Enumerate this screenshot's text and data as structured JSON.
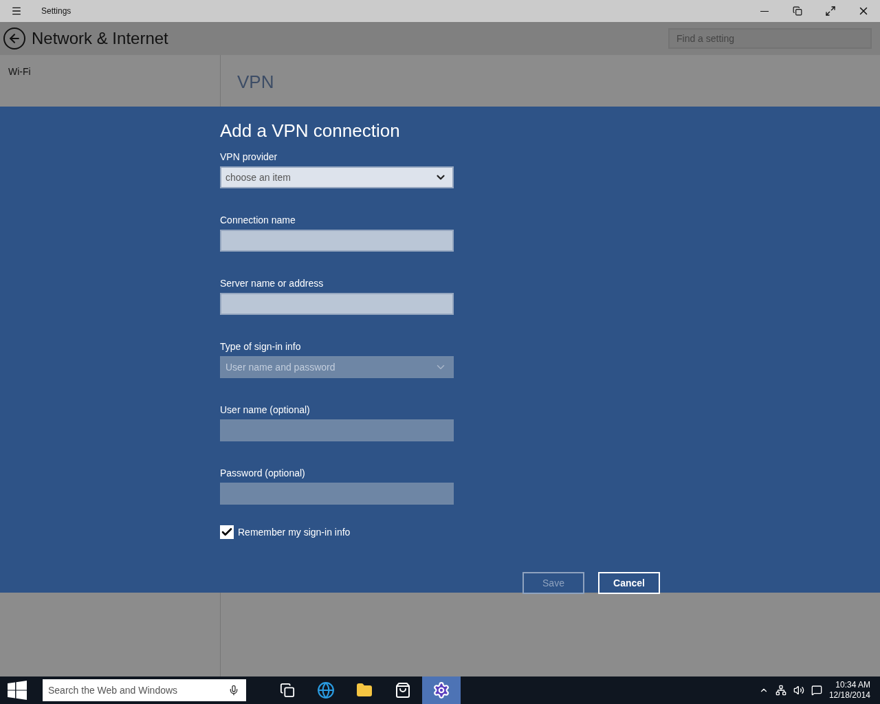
{
  "window": {
    "title": "Settings"
  },
  "header": {
    "title": "Network & Internet",
    "search": {
      "placeholder": "Find a setting"
    }
  },
  "sidebar": {
    "items": [
      {
        "label": "Wi-Fi"
      }
    ]
  },
  "page": {
    "title": "VPN"
  },
  "dialog": {
    "title": "Add a VPN connection",
    "fields": [
      {
        "kind": "select",
        "label": "VPN provider",
        "value": "choose an item",
        "disabled": false
      },
      {
        "kind": "text",
        "label": "Connection name",
        "disabled": false
      },
      {
        "kind": "text",
        "label": "Server name or address",
        "disabled": false
      },
      {
        "kind": "select",
        "label": "Type of sign-in info",
        "value": "User name and password",
        "disabled": true
      },
      {
        "kind": "text",
        "label": "User name (optional)",
        "disabled": true
      },
      {
        "kind": "text",
        "label": "Password (optional)",
        "disabled": true
      }
    ],
    "remember": {
      "label": "Remember my sign-in info",
      "checked": true
    },
    "buttons": [
      {
        "label": "Save",
        "disabled": true
      },
      {
        "label": "Cancel",
        "disabled": false
      }
    ]
  },
  "taskbar": {
    "search": {
      "placeholder": "Search the Web and Windows"
    },
    "apps": [
      {
        "kind": "taskview",
        "selected": false
      },
      {
        "kind": "browser",
        "selected": false
      },
      {
        "kind": "folder",
        "selected": false
      },
      {
        "kind": "store",
        "selected": false
      },
      {
        "kind": "settings",
        "selected": true
      }
    ],
    "clock": {
      "time": "10:34 AM",
      "date": "12/18/2014"
    }
  }
}
